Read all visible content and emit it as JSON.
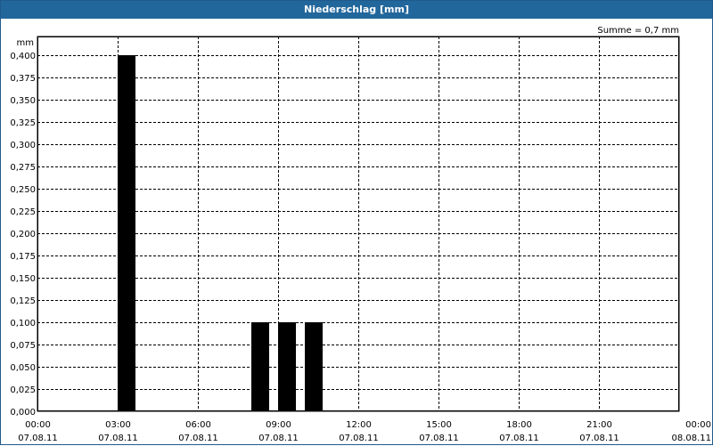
{
  "window": {
    "title": "Niederschlag [mm]"
  },
  "chart_data": {
    "type": "bar",
    "title": "Niederschlag [mm]",
    "ylabel": "mm",
    "sum_label": "Summe = 0,7 mm",
    "ylim": [
      0,
      0.4
    ],
    "yticks": [
      "0,000",
      "0,025",
      "0,050",
      "0,075",
      "0,100",
      "0,125",
      "0,150",
      "0,175",
      "0,200",
      "0,225",
      "0,250",
      "0,275",
      "0,300",
      "0,325",
      "0,350",
      "0,375",
      "0,400"
    ],
    "xlim_hours": [
      0,
      24
    ],
    "xticks": [
      {
        "time": "00:00",
        "date": "07.08.11"
      },
      {
        "time": "03:00",
        "date": "07.08.11"
      },
      {
        "time": "06:00",
        "date": "07.08.11"
      },
      {
        "time": "09:00",
        "date": "07.08.11"
      },
      {
        "time": "12:00",
        "date": "07.08.11"
      },
      {
        "time": "15:00",
        "date": "07.08.11"
      },
      {
        "time": "18:00",
        "date": "07.08.11"
      },
      {
        "time": "21:00",
        "date": "07.08.11"
      },
      {
        "time": "00:00",
        "date": "08.08.11"
      }
    ],
    "bar_color": "#000000",
    "grid": true,
    "series": [
      {
        "values": [
          {
            "start": "03:00",
            "end": "03:40",
            "value": 0.4
          },
          {
            "start": "08:00",
            "end": "08:40",
            "value": 0.1
          },
          {
            "start": "09:00",
            "end": "09:40",
            "value": 0.1
          },
          {
            "start": "10:00",
            "end": "10:40",
            "value": 0.1
          }
        ]
      }
    ]
  }
}
